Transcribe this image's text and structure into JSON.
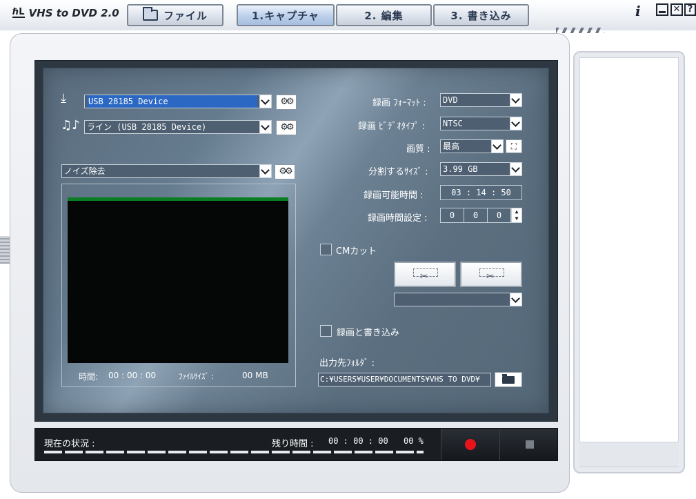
{
  "app": {
    "logo_mark": "ℏL",
    "title": "VHS to DVD 2.0"
  },
  "toolbar": {
    "file_label": "ファイル"
  },
  "tabs": [
    {
      "label": "1.キャプチャ",
      "active": true
    },
    {
      "label": "2. 編集",
      "active": false
    },
    {
      "label": "3. 書き込み",
      "active": false
    }
  ],
  "window_controls": {
    "info": "i",
    "help": "?",
    "maximize": "✕"
  },
  "sources": {
    "video_device": "USB 28185 Device",
    "audio_device": "ライン (USB 28185 Device)",
    "filter": "ノイズ除去",
    "audio_icon": "♫♪"
  },
  "preview_info": {
    "time_label": "時間:",
    "time_value": "00 : 00 : 00",
    "filesize_label": "ﾌｧｲﾙｻｲｽﾞ :",
    "filesize_value": "00 MB"
  },
  "settings": {
    "format_label": "録画 ﾌｫｰﾏｯﾄ :",
    "format_value": "DVD",
    "videotype_label": "録画 ﾋﾞﾃﾞｵﾀｲﾌﾟ :",
    "videotype_value": "NTSC",
    "quality_label": "画質 :",
    "quality_value": "最高",
    "split_label": "分割するｻｲｽﾞ :",
    "split_value": "3.99 GB",
    "available_label": "録画可能時間   :",
    "available_value": "03 : 14 : 50",
    "timer_label": "録画時間設定 :",
    "timer_h": "0",
    "timer_m": "0",
    "timer_s": "0"
  },
  "cm_cut": {
    "label": "CMカット",
    "checked": false,
    "dropdown_value": ""
  },
  "record_and_burn": {
    "label": "録画と書き込み",
    "checked": false
  },
  "output": {
    "label": "出力先ﾌｫﾙﾀﾞ :",
    "path": "C:¥USERS¥USER¥DOCUMENTS¥VHS TO DVD¥"
  },
  "status": {
    "current_label": "現在の状況 :",
    "remaining_label": "残り時間 :",
    "remaining_value": "00 : 00 : 00",
    "percent": "00 %"
  },
  "colors": {
    "record": "#e8141c",
    "panel": "#5a6c7d",
    "selection": "#2b68c4"
  }
}
